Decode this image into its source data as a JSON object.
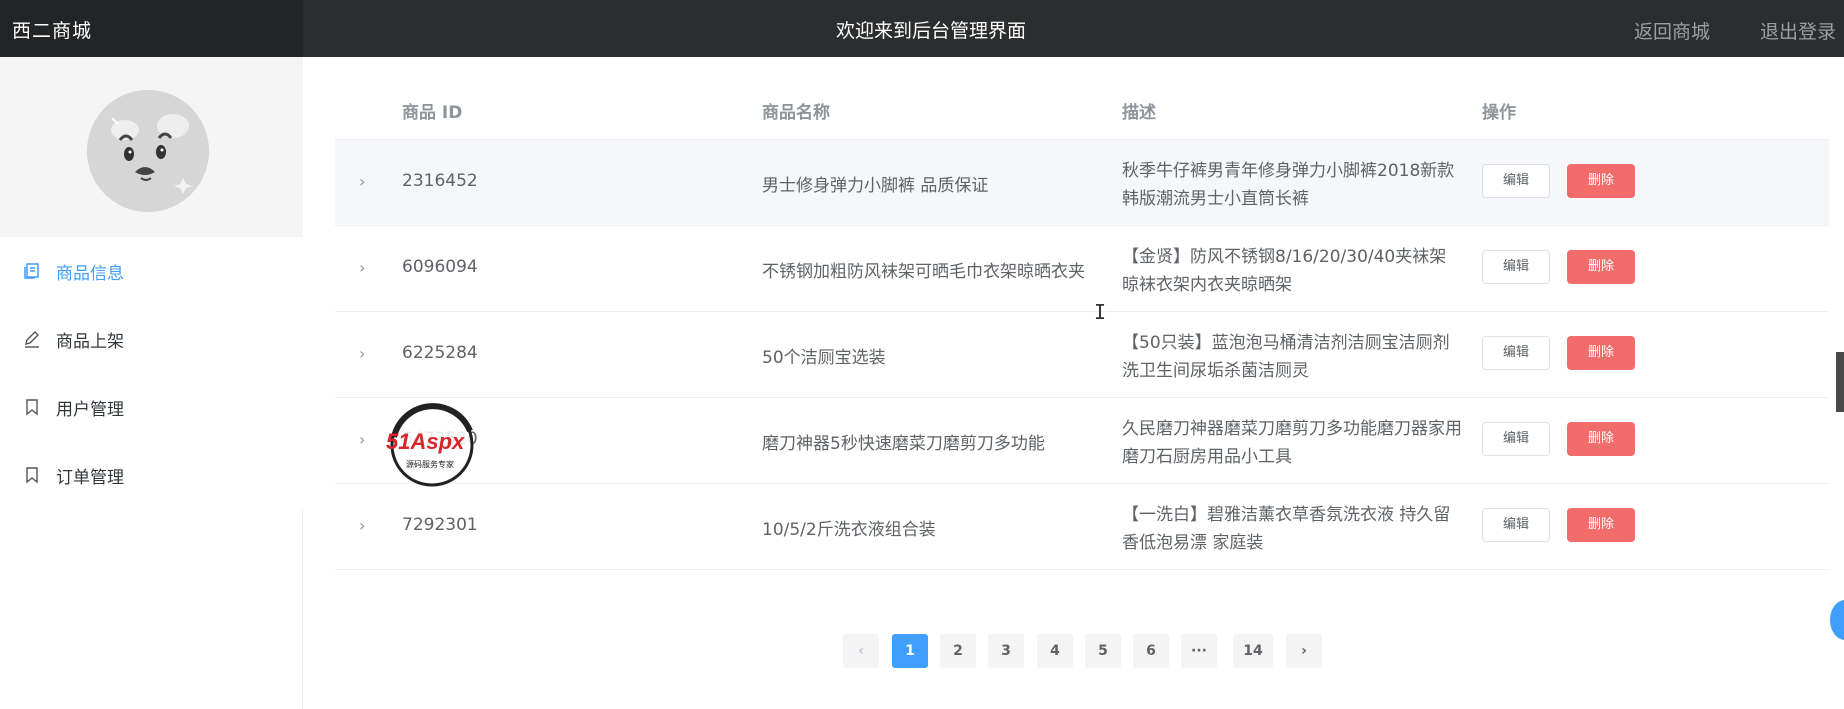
{
  "header": {
    "brand": "西二商城",
    "title": "欢迎来到后台管理界面",
    "back_link": "返回商城",
    "logout_link": "退出登录"
  },
  "sidebar": {
    "items": [
      {
        "label": "商品信息",
        "icon": "document-icon",
        "active": true
      },
      {
        "label": "商品上架",
        "icon": "pencil-icon",
        "active": false
      },
      {
        "label": "用户管理",
        "icon": "bookmark-icon",
        "active": false
      },
      {
        "label": "订单管理",
        "icon": "bookmark-icon",
        "active": false
      }
    ]
  },
  "table": {
    "columns": [
      "商品 ID",
      "商品名称",
      "描述",
      "操作"
    ],
    "edit_label": "编辑",
    "delete_label": "删除",
    "rows": [
      {
        "id": "2316452",
        "name": "男士修身弹力小脚裤 品质保证",
        "desc": "秋季牛仔裤男青年修身弹力小脚裤2018新款韩版潮流男士小直筒长裤"
      },
      {
        "id": "6096094",
        "name": "不锈钢加粗防风袜架可晒毛巾衣架晾晒衣夹",
        "desc": "【金贤】防风不锈钢8/16/20/30/40夹袜架晾袜衣架内衣夹晾晒架"
      },
      {
        "id": "6225284",
        "name": "50个洁厕宝选装",
        "desc": "【50只装】蓝泡泡马桶清洁剂洁厕宝洁厕剂洗卫生间尿垢杀菌洁厕灵"
      },
      {
        "id": "6473520",
        "name": "磨刀神器5秒快速磨菜刀磨剪刀多功能",
        "desc": "久民磨刀神器磨菜刀磨剪刀多功能磨刀器家用磨刀石厨房用品小工具"
      },
      {
        "id": "7292301",
        "name": "10/5/2斤洗衣液组合装",
        "desc": "【一洗白】碧雅洁薰衣草香氛洗衣液 持久留香低泡易漂 家庭装"
      }
    ]
  },
  "pagination": {
    "pages": [
      "1",
      "2",
      "3",
      "4",
      "5",
      "6",
      "···",
      "14"
    ],
    "current": "1",
    "prev": "‹",
    "next": "›"
  },
  "watermark": {
    "text": "51Aspx",
    "subtext": "源码服务专家"
  },
  "colors": {
    "accent": "#409eff",
    "danger": "#f36c6c",
    "header_bg": "#2b2d2e"
  }
}
